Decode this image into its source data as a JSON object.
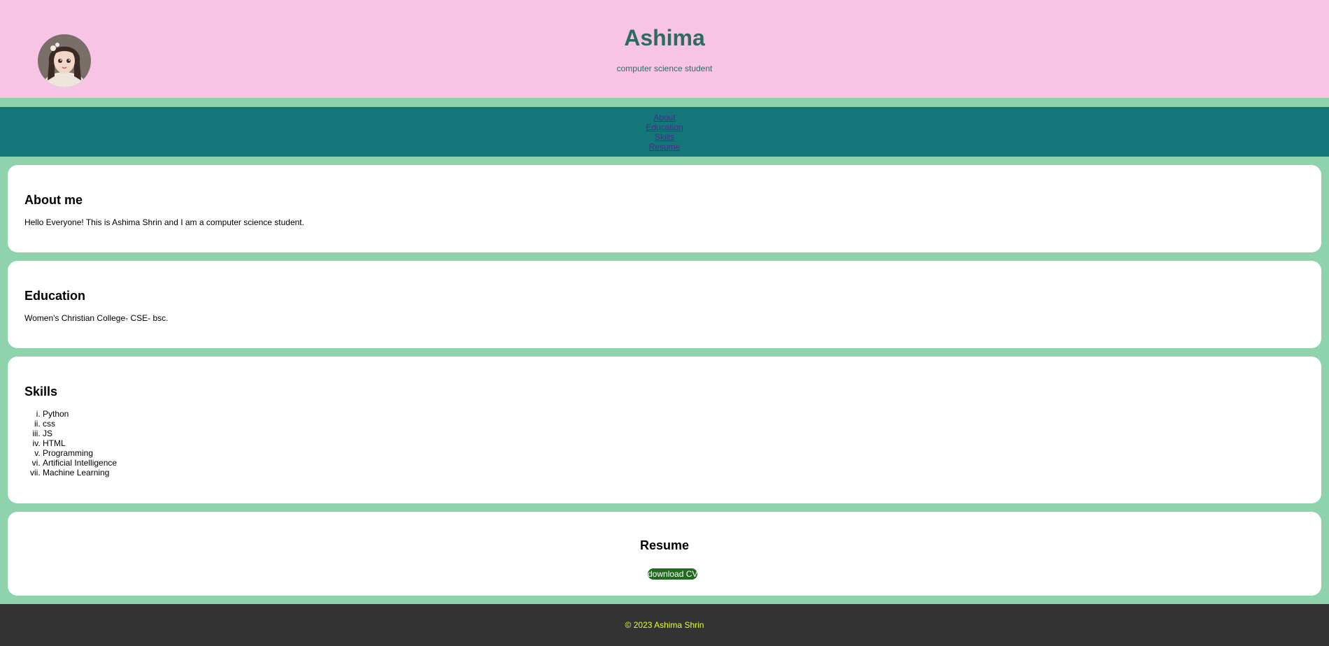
{
  "header": {
    "title": "Ashima",
    "subtitle": "computer science student"
  },
  "nav": {
    "items": [
      "About",
      "Education",
      "Skills",
      "Resume"
    ]
  },
  "about": {
    "heading": "About me",
    "text": "Hello Everyone! This is Ashima Shrin and I am a computer science student."
  },
  "education": {
    "heading": "Education",
    "text": "Women's Christian College- CSE- bsc."
  },
  "skills": {
    "heading": "Skills",
    "items": [
      "Python",
      "css",
      "JS",
      "HTML",
      "Programming",
      "Artificial Intelligence",
      "Machine Learning"
    ]
  },
  "resume": {
    "heading": "Resume",
    "button_label": "download CV"
  },
  "footer": {
    "text": "© 2023 Ashima Shrin"
  },
  "colors": {
    "header_bg": "#f7c4e5",
    "nav_bg": "#147679",
    "page_bg": "#8fd3ac",
    "title": "#2e6b5e",
    "button_bg": "#1f6b1f",
    "footer_bg": "#333333",
    "footer_text": "#e8ff2a"
  }
}
